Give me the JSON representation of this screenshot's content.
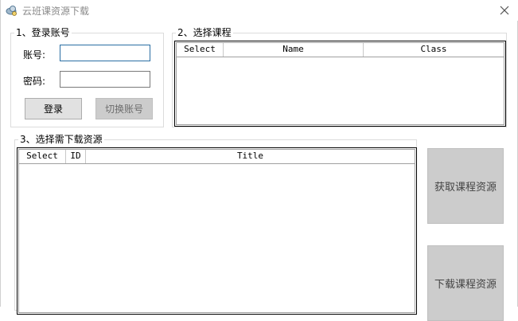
{
  "window": {
    "title": "云班课资源下载",
    "icon": "cloud-gear-icon",
    "close": "×"
  },
  "login": {
    "legend": "1、登录账号",
    "account_label": "账号:",
    "account_value": "",
    "password_label": "密码:",
    "password_value": "",
    "login_button": "登录",
    "switch_button": "切换账号"
  },
  "courses": {
    "legend": "2、选择课程",
    "columns": [
      "Select",
      "Name",
      "Class"
    ],
    "rows": []
  },
  "resources": {
    "legend": "3、选择需下载资源",
    "columns": [
      "Select",
      "ID",
      "Title"
    ],
    "rows": []
  },
  "actions": {
    "fetch_button": "获取课程资源",
    "download_button": "下载课程资源"
  },
  "colors": {
    "focus_border": "#2a6ea3",
    "disabled_button": "#cccccc",
    "title_text": "#8a8a8a"
  }
}
